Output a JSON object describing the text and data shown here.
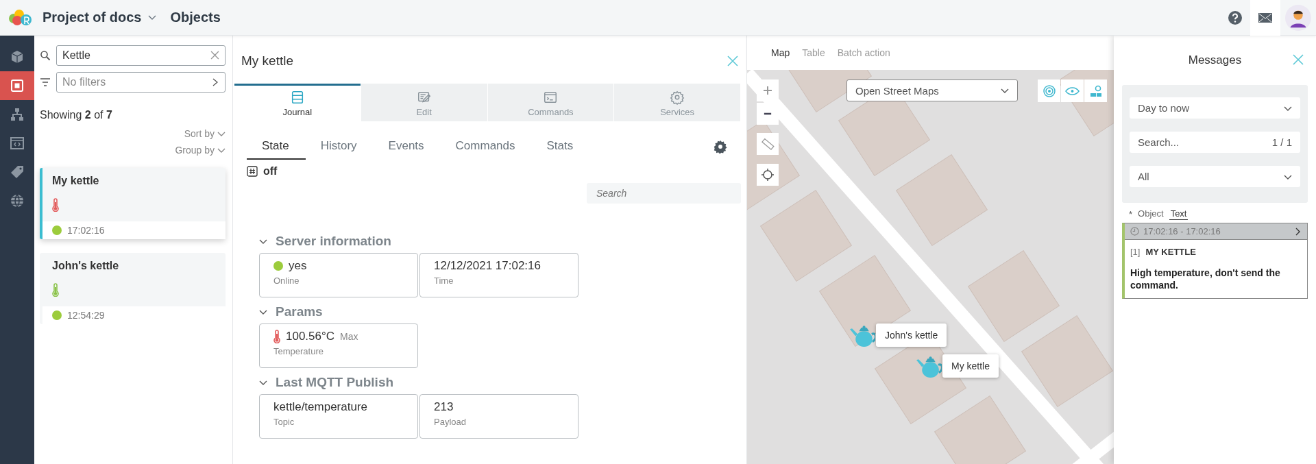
{
  "header": {
    "project": "Project of docs",
    "page": "Objects"
  },
  "nav": [
    {
      "kind": "cube",
      "selected": false
    },
    {
      "kind": "objects",
      "selected": true
    },
    {
      "kind": "hierarchy",
      "selected": false
    },
    {
      "kind": "code",
      "selected": false
    },
    {
      "kind": "tag",
      "selected": false
    },
    {
      "kind": "globe",
      "selected": false
    }
  ],
  "object_list": {
    "search_value": "Kettle",
    "filter_placeholder": "No filters",
    "showing": "Showing **2** of **7**",
    "sort_by": "Sort by",
    "group_by": "Group by",
    "items": [
      {
        "name": "My kettle",
        "selected": true,
        "color": "#e35d5d",
        "online": true,
        "time": "17:02:16"
      },
      {
        "name": "John's kettle",
        "selected": false,
        "color": "#8bc34a",
        "online": true,
        "time": "12:54:29"
      }
    ]
  },
  "detail": {
    "title": "My kettle",
    "tabs": [
      {
        "label": "Journal",
        "kind": "journal",
        "selected": true
      },
      {
        "label": "Edit",
        "kind": "edit",
        "selected": false
      },
      {
        "label": "Commands",
        "kind": "commands",
        "selected": false
      },
      {
        "label": "Services",
        "kind": "services",
        "selected": false
      }
    ],
    "subtabs": [
      {
        "label": "State",
        "selected": true
      },
      {
        "label": "History",
        "selected": false
      },
      {
        "label": "Events",
        "selected": false
      },
      {
        "label": "Commands",
        "selected": false
      },
      {
        "label": "Stats",
        "selected": false
      }
    ],
    "state": "off",
    "search_placeholder": "Search",
    "sections": [
      {
        "title": "Server information",
        "expanded": true,
        "fields": [
          {
            "kind": "status",
            "value": "yes",
            "label": "Online",
            "online": true
          },
          {
            "kind": "plain",
            "value": "12/12/2021 17:02:16",
            "label": "Time"
          }
        ]
      },
      {
        "title": "Params",
        "expanded": true,
        "fields": [
          {
            "kind": "sensor",
            "value": "100.56°C",
            "note": "Max",
            "label": "Temperature",
            "color": "#e35d5d"
          }
        ]
      },
      {
        "title": "Last MQTT Publish",
        "expanded": true,
        "fields": [
          {
            "kind": "plain",
            "value": "kettle/temperature",
            "label": "Topic"
          },
          {
            "kind": "plain",
            "value": "213",
            "label": "Payload"
          }
        ]
      }
    ]
  },
  "map": {
    "tabs": [
      {
        "label": "Map",
        "selected": true
      },
      {
        "label": "Table",
        "selected": false
      },
      {
        "label": "Batch action",
        "selected": false
      }
    ],
    "layer": "Open Street Maps",
    "markers": [
      {
        "label": "John's kettle"
      },
      {
        "label": "My kettle"
      }
    ]
  },
  "messages": {
    "title": "Messages",
    "period": "Day to now",
    "search_placeholder": "Search...",
    "counter": "1 / 1",
    "type": "All",
    "marker": "*",
    "view_tabs": [
      {
        "label": "Object",
        "selected": false
      },
      {
        "label": "Text",
        "selected": true
      }
    ],
    "items": [
      {
        "range": "17:02:16 - 17:02:16",
        "index": "[1]",
        "object": "MY KETTLE",
        "text": "High temperature, don't send the command."
      }
    ]
  }
}
